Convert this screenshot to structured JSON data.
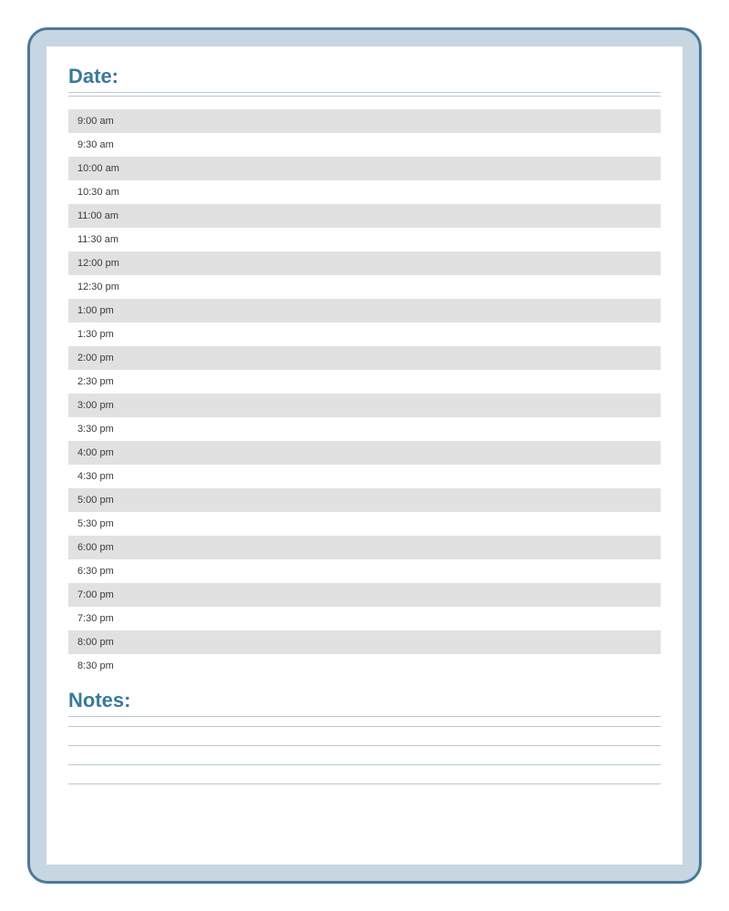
{
  "header": {
    "date_label": "Date:"
  },
  "schedule": {
    "times": [
      "9:00 am",
      "9:30 am",
      "10:00 am",
      "10:30 am",
      "11:00 am",
      "11:30 am",
      "12:00 pm",
      "12:30 pm",
      "1:00 pm",
      "1:30 pm",
      "2:00 pm",
      "2:30 pm",
      "3:00 pm",
      "3:30 pm",
      "4:00 pm",
      "4:30 pm",
      "5:00 pm",
      "5:30 pm",
      "6:00 pm",
      "6:30 pm",
      "7:00 pm",
      "7:30 pm",
      "8:00 pm",
      "8:30 pm"
    ]
  },
  "notes": {
    "label": "Notes:",
    "line_count": 4
  }
}
